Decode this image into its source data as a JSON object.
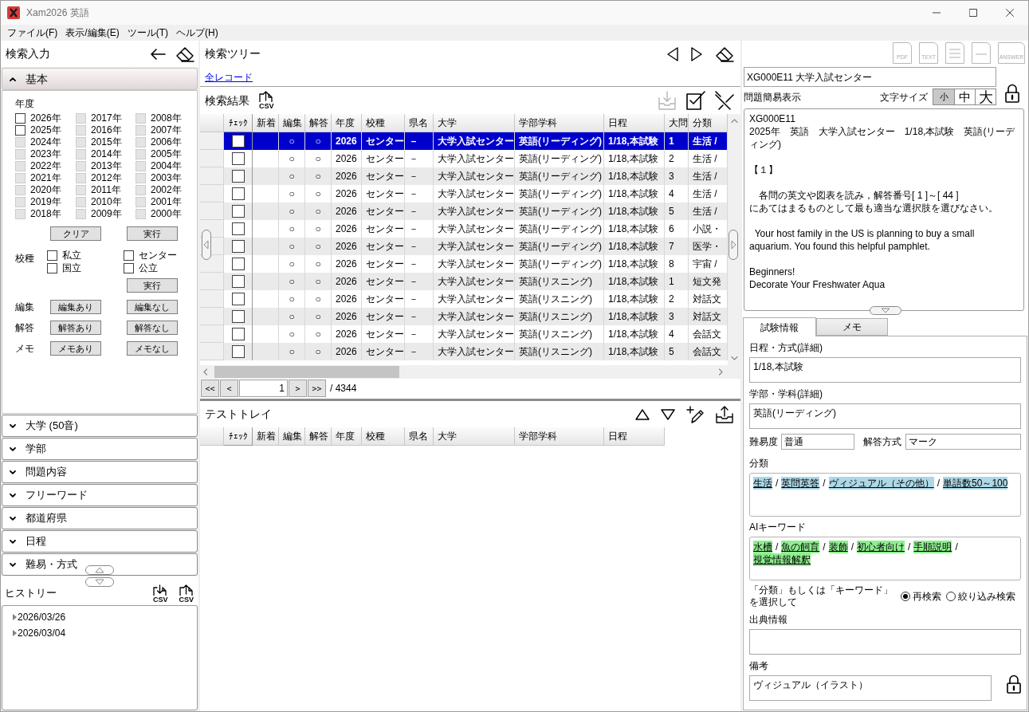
{
  "window": {
    "title": "Xam2026 英語"
  },
  "menu": [
    {
      "label": "ファイル(F)"
    },
    {
      "label": "表示/編集(E)"
    },
    {
      "label": "ツール(T)"
    },
    {
      "label": "ヘルプ(H)"
    }
  ],
  "search_input": {
    "title": "検索入力",
    "basic": {
      "label": "基本",
      "expanded": true,
      "year_label": "年度",
      "years": [
        {
          "label": "2026年",
          "checked": false,
          "disabled": false
        },
        {
          "label": "2025年",
          "checked": false,
          "disabled": false
        },
        {
          "label": "2024年",
          "checked": false,
          "disabled": true
        },
        {
          "label": "2023年",
          "checked": false,
          "disabled": true
        },
        {
          "label": "2022年",
          "checked": false,
          "disabled": true
        },
        {
          "label": "2021年",
          "checked": false,
          "disabled": true
        },
        {
          "label": "2020年",
          "checked": false,
          "disabled": true
        },
        {
          "label": "2019年",
          "checked": false,
          "disabled": true
        },
        {
          "label": "2018年",
          "checked": false,
          "disabled": true
        },
        {
          "label": "2017年",
          "checked": false,
          "disabled": true
        },
        {
          "label": "2016年",
          "checked": false,
          "disabled": true
        },
        {
          "label": "2015年",
          "checked": false,
          "disabled": true
        },
        {
          "label": "2014年",
          "checked": false,
          "disabled": true
        },
        {
          "label": "2013年",
          "checked": false,
          "disabled": true
        },
        {
          "label": "2012年",
          "checked": false,
          "disabled": true
        },
        {
          "label": "2011年",
          "checked": false,
          "disabled": true
        },
        {
          "label": "2010年",
          "checked": false,
          "disabled": true
        },
        {
          "label": "2009年",
          "checked": false,
          "disabled": true
        },
        {
          "label": "2008年",
          "checked": false,
          "disabled": true
        },
        {
          "label": "2007年",
          "checked": false,
          "disabled": true
        },
        {
          "label": "2006年",
          "checked": false,
          "disabled": true
        },
        {
          "label": "2005年",
          "checked": false,
          "disabled": true
        },
        {
          "label": "2004年",
          "checked": false,
          "disabled": true
        },
        {
          "label": "2003年",
          "checked": false,
          "disabled": true
        },
        {
          "label": "2002年",
          "checked": false,
          "disabled": true
        },
        {
          "label": "2001年",
          "checked": false,
          "disabled": true
        },
        {
          "label": "2000年",
          "checked": false,
          "disabled": true
        }
      ],
      "clear_button": "クリア",
      "run_button": "実行",
      "school_type_label": "校種",
      "school_types": [
        {
          "label": "私立",
          "checked": false
        },
        {
          "label": "センター",
          "checked": false
        },
        {
          "label": "国立",
          "checked": false
        },
        {
          "label": "公立",
          "checked": false
        }
      ],
      "school_type_run_button": "実行",
      "filters": [
        {
          "label": "編集",
          "options": [
            "編集あり",
            "編集なし"
          ]
        },
        {
          "label": "解答",
          "options": [
            "解答あり",
            "解答なし"
          ]
        },
        {
          "label": "メモ",
          "options": [
            "メモあり",
            "メモなし"
          ]
        }
      ]
    },
    "sections": [
      {
        "label": "大学 (50音)",
        "expanded": false
      },
      {
        "label": "学部",
        "expanded": false
      },
      {
        "label": "問題内容",
        "expanded": false
      },
      {
        "label": "フリーワード",
        "expanded": false
      },
      {
        "label": "都道府県",
        "expanded": false
      },
      {
        "label": "日程",
        "expanded": false
      },
      {
        "label": "難易・方式",
        "expanded": false
      }
    ]
  },
  "history": {
    "title": "ヒストリー",
    "import_label": "CSV",
    "export_label": "CSV",
    "items": [
      {
        "label": "2026/03/26",
        "expanded": false
      },
      {
        "label": "2026/03/04",
        "expanded": false
      }
    ]
  },
  "search_tree": {
    "title": "検索ツリー",
    "link": "全レコード"
  },
  "results": {
    "title": "検索結果",
    "csv_label": "CSV",
    "tools": [
      {
        "kind": "import",
        "disabled": true
      },
      {
        "kind": "check_all",
        "disabled": false
      },
      {
        "kind": "clear_checks",
        "disabled": false
      }
    ],
    "columns": [
      "ﾁｪｯｸ",
      "新着",
      "編集",
      "解答",
      "年度",
      "校種",
      "県名",
      "大学",
      "学部学科",
      "日程",
      "大問",
      "分類"
    ],
    "rows": [
      {
        "selected": true,
        "checked": false,
        "edit": "○",
        "answer": "○",
        "year": "2026",
        "school_type": "センター",
        "prefecture": "－",
        "university": "大学入試センター",
        "department": "英語(リーディング)",
        "schedule": "1/18,本試験",
        "question": "1",
        "category": "生活 /"
      },
      {
        "selected": false,
        "checked": false,
        "edit": "○",
        "answer": "○",
        "year": "2026",
        "school_type": "センター",
        "prefecture": "－",
        "university": "大学入試センター",
        "department": "英語(リーディング)",
        "schedule": "1/18,本試験",
        "question": "2",
        "category": "生活 /"
      },
      {
        "selected": false,
        "checked": false,
        "edit": "○",
        "answer": "○",
        "year": "2026",
        "school_type": "センター",
        "prefecture": "－",
        "university": "大学入試センター",
        "department": "英語(リーディング)",
        "schedule": "1/18,本試験",
        "question": "3",
        "category": "生活 /"
      },
      {
        "selected": false,
        "checked": false,
        "edit": "○",
        "answer": "○",
        "year": "2026",
        "school_type": "センター",
        "prefecture": "－",
        "university": "大学入試センター",
        "department": "英語(リーディング)",
        "schedule": "1/18,本試験",
        "question": "4",
        "category": "生活 /"
      },
      {
        "selected": false,
        "checked": false,
        "edit": "○",
        "answer": "○",
        "year": "2026",
        "school_type": "センター",
        "prefecture": "－",
        "university": "大学入試センター",
        "department": "英語(リーディング)",
        "schedule": "1/18,本試験",
        "question": "5",
        "category": "生活 /"
      },
      {
        "selected": false,
        "checked": false,
        "edit": "○",
        "answer": "○",
        "year": "2026",
        "school_type": "センター",
        "prefecture": "－",
        "university": "大学入試センター",
        "department": "英語(リーディング)",
        "schedule": "1/18,本試験",
        "question": "6",
        "category": "小説・"
      },
      {
        "selected": false,
        "checked": false,
        "edit": "○",
        "answer": "○",
        "year": "2026",
        "school_type": "センター",
        "prefecture": "－",
        "university": "大学入試センター",
        "department": "英語(リーディング)",
        "schedule": "1/18,本試験",
        "question": "7",
        "category": "医学・"
      },
      {
        "selected": false,
        "checked": false,
        "edit": "○",
        "answer": "○",
        "year": "2026",
        "school_type": "センター",
        "prefecture": "－",
        "university": "大学入試センター",
        "department": "英語(リーディング)",
        "schedule": "1/18,本試験",
        "question": "8",
        "category": "宇宙 /"
      },
      {
        "selected": false,
        "checked": false,
        "edit": "○",
        "answer": "○",
        "year": "2026",
        "school_type": "センター",
        "prefecture": "－",
        "university": "大学入試センター",
        "department": "英語(リスニング)",
        "schedule": "1/18,本試験",
        "question": "1",
        "category": "短文発"
      },
      {
        "selected": false,
        "checked": false,
        "edit": "○",
        "answer": "○",
        "year": "2026",
        "school_type": "センター",
        "prefecture": "－",
        "university": "大学入試センター",
        "department": "英語(リスニング)",
        "schedule": "1/18,本試験",
        "question": "2",
        "category": "対話文"
      },
      {
        "selected": false,
        "checked": false,
        "edit": "○",
        "answer": "○",
        "year": "2026",
        "school_type": "センター",
        "prefecture": "－",
        "university": "大学入試センター",
        "department": "英語(リスニング)",
        "schedule": "1/18,本試験",
        "question": "3",
        "category": "対話文"
      },
      {
        "selected": false,
        "checked": false,
        "edit": "○",
        "answer": "○",
        "year": "2026",
        "school_type": "センター",
        "prefecture": "－",
        "university": "大学入試センター",
        "department": "英語(リスニング)",
        "schedule": "1/18,本試験",
        "question": "4",
        "category": "会話文"
      },
      {
        "selected": false,
        "checked": false,
        "edit": "○",
        "answer": "○",
        "year": "2026",
        "school_type": "センター",
        "prefecture": "－",
        "university": "大学入試センター",
        "department": "英語(リスニング)",
        "schedule": "1/18,本試験",
        "question": "5",
        "category": "会話文"
      }
    ],
    "pagination": {
      "first": "<<",
      "prev": "<",
      "page": "1",
      "next": ">",
      "last": ">>",
      "total": "/ 4344"
    }
  },
  "test_tray": {
    "title": "テストトレイ",
    "columns": [
      "ﾁｪｯｸ",
      "新着",
      "編集",
      "解答",
      "年度",
      "校種",
      "県名",
      "大学",
      "学部学科",
      "日程"
    ]
  },
  "question": {
    "tools": [
      {
        "kind": "pdf",
        "label": "PDF",
        "disabled": true
      },
      {
        "kind": "text",
        "label": "TEXT",
        "disabled": true
      },
      {
        "kind": "lines",
        "disabled": true
      },
      {
        "kind": "line",
        "disabled": true
      },
      {
        "kind": "answer",
        "label": "ANSWER",
        "disabled": true
      }
    ],
    "title_field": "XG000E11 大学入試センター",
    "simple_view_label": "問題簡易表示",
    "font_size_label": "文字サイズ",
    "font_sizes": [
      {
        "label": "小",
        "selected": true
      },
      {
        "label": "中",
        "selected": false
      },
      {
        "label": "大",
        "selected": false
      }
    ],
    "paragraphs": [
      [
        "XG000E11",
        "2025年　英語　大学入試センター　1/18,本試験　英語(リーディング)"
      ],
      [
        "【１】"
      ],
      [
        "　各問の英文や図表を読み，解答番号[ 1 ]～[ 44 ]",
        "にあてはまるものとして最も適当な選択肢を選びなさい。"
      ],
      [
        "  Your host family in the US is planning to buy a small aquarium. You found this helpful pamphlet."
      ],
      [
        "Beginners!",
        "Decorate Your Freshwater Aqua"
      ]
    ]
  },
  "exam_info": {
    "tabs": [
      {
        "label": "試験情報",
        "selected": true
      },
      {
        "label": "メモ",
        "selected": false
      }
    ],
    "schedule": {
      "label": "日程・方式(詳細)",
      "value": "1/18,本試験"
    },
    "department": {
      "label": "学部・学科(詳細)",
      "value": "英語(リーディング)"
    },
    "difficulty": {
      "label": "難易度",
      "value": "普通"
    },
    "answer_format": {
      "label": "解答方式",
      "value": "マーク"
    },
    "categories": {
      "label": "分類",
      "separator": "/",
      "tags": [
        "生活",
        "英問英答",
        "ヴィジュアル（その他）",
        "単語数50～100"
      ]
    },
    "keywords": {
      "label": "AIキーワード",
      "separator": "/",
      "tags": [
        "水槽",
        "魚の飼育",
        "装飾",
        "初心者向け",
        "手順説明",
        "視覚情報解釈"
      ]
    },
    "search_mode": {
      "prompt": "「分類」もしくは「キーワード」を選択して",
      "options": [
        {
          "label": "再検索",
          "selected": true
        },
        {
          "label": "絞り込み検索",
          "selected": false
        }
      ]
    },
    "source": {
      "label": "出典情報"
    },
    "notes": {
      "label": "備考",
      "value": "ヴィジュアル（イラスト）"
    }
  }
}
